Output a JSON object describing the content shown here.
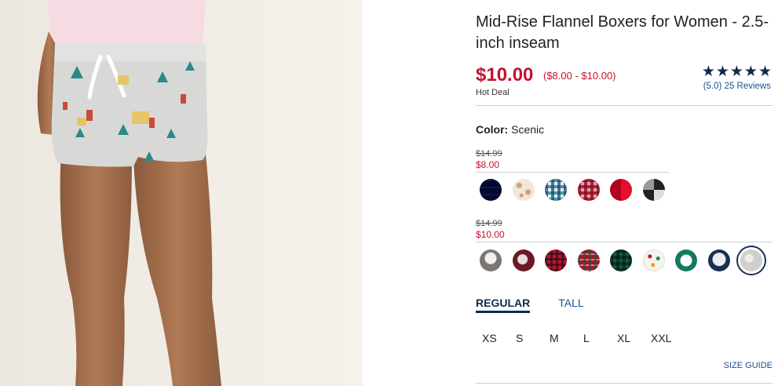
{
  "product": {
    "title": "Mid-Rise Flannel Boxers for Women - 2.5-inch inseam",
    "price": "$10.00",
    "price_range": "($8.00 - $10.00)",
    "deal_label": "Hot Deal",
    "rating_stars": "★★★★★",
    "reviews_text": "(5.0) 25 Reviews"
  },
  "color": {
    "label": "Color:",
    "value": "Scenic"
  },
  "groups": [
    {
      "original_price": "$14.99",
      "sale_price": "$8.00",
      "swatches": [
        "navy-check",
        "beige-leopard",
        "teal-plaid",
        "red-gingham",
        "red-buffalo-check",
        "black-white-check"
      ]
    },
    {
      "original_price": "$14.99",
      "sale_price": "$10.00",
      "swatches": [
        "gray-print",
        "burgundy-print",
        "red-plaid",
        "red-green-plaid",
        "green-plaid",
        "white-dots",
        "green-sheep",
        "navy-llama",
        "scenic-selected"
      ]
    }
  ],
  "fit_tabs": [
    "REGULAR",
    "TALL"
  ],
  "sizes": [
    "XS",
    "S",
    "M",
    "L",
    "XL",
    "XXL"
  ],
  "size_guide": "SIZE GUIDE",
  "colors": {
    "sale_red": "#c8102e",
    "navy": "#102a51",
    "link_blue": "#1d4f91"
  }
}
